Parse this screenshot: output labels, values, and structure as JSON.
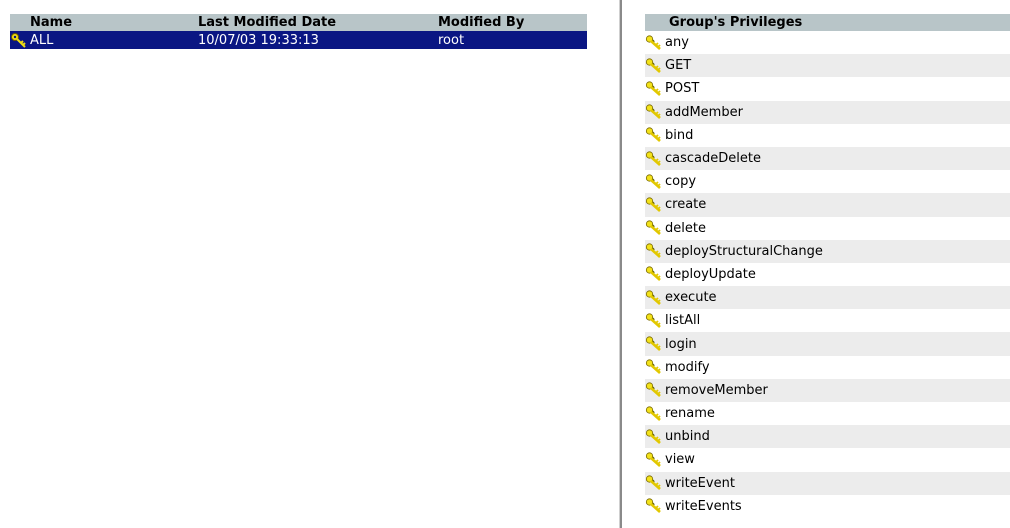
{
  "groups_table": {
    "columns": {
      "name": "Name",
      "date": "Last Modified Date",
      "by": "Modified By"
    },
    "rows": [
      {
        "name": "ALL",
        "date": "10/07/03 19:33:13",
        "by": "root",
        "selected": true
      }
    ]
  },
  "privileges": {
    "header": "Group's Privileges",
    "icon": "key-icon",
    "items": [
      "any",
      "GET",
      "POST",
      "addMember",
      "bind",
      "cascadeDelete",
      "copy",
      "create",
      "delete",
      "deployStructuralChange",
      "deployUpdate",
      "execute",
      "listAll",
      "login",
      "modify",
      "removeMember",
      "rename",
      "unbind",
      "view",
      "writeEvent",
      "writeEvents"
    ]
  },
  "colors": {
    "header_bg": "#b8c5c8",
    "selection_bg": "#0a1683",
    "key_yellow": "#e8d200"
  }
}
